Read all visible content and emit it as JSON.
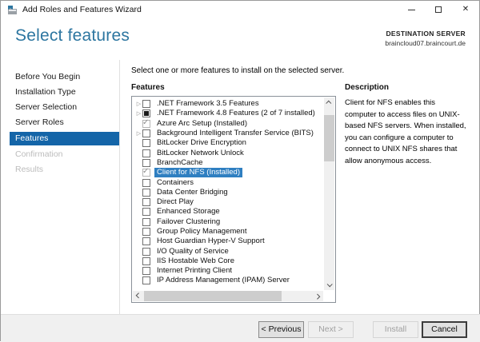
{
  "window": {
    "title": "Add Roles and Features Wizard"
  },
  "icons": {
    "expand": "▷",
    "check": "✓",
    "close": "✕"
  },
  "header": {
    "title": "Select features",
    "destination_label": "DESTINATION SERVER",
    "destination_server": "braincloud07.braincourt.de"
  },
  "sidebar": {
    "items": [
      {
        "label": "Before You Begin",
        "state": "normal"
      },
      {
        "label": "Installation Type",
        "state": "normal"
      },
      {
        "label": "Server Selection",
        "state": "normal"
      },
      {
        "label": "Server Roles",
        "state": "normal"
      },
      {
        "label": "Features",
        "state": "selected"
      },
      {
        "label": "Confirmation",
        "state": "disabled"
      },
      {
        "label": "Results",
        "state": "disabled"
      }
    ]
  },
  "main": {
    "instruction": "Select one or more features to install on the selected server.",
    "features_label": "Features",
    "description_label": "Description",
    "description_text": "Client for NFS enables this computer to access files on UNIX-based NFS servers. When installed, you can configure a computer to connect to UNIX NFS shares that allow anonymous access.",
    "features": [
      {
        "label": ".NET Framework 3.5 Features",
        "checkbox": "unchecked",
        "expandable": true,
        "selected": false
      },
      {
        "label": ".NET Framework 4.8 Features (2 of 7 installed)",
        "checkbox": "partial",
        "expandable": true,
        "selected": false
      },
      {
        "label": "Azure Arc Setup (Installed)",
        "checkbox": "checked",
        "expandable": false,
        "selected": false
      },
      {
        "label": "Background Intelligent Transfer Service (BITS)",
        "checkbox": "unchecked",
        "expandable": true,
        "selected": false
      },
      {
        "label": "BitLocker Drive Encryption",
        "checkbox": "unchecked",
        "expandable": false,
        "selected": false
      },
      {
        "label": "BitLocker Network Unlock",
        "checkbox": "unchecked",
        "expandable": false,
        "selected": false
      },
      {
        "label": "BranchCache",
        "checkbox": "unchecked",
        "expandable": false,
        "selected": false
      },
      {
        "label": "Client for NFS (Installed)",
        "checkbox": "checked",
        "expandable": false,
        "selected": true
      },
      {
        "label": "Containers",
        "checkbox": "unchecked",
        "expandable": false,
        "selected": false
      },
      {
        "label": "Data Center Bridging",
        "checkbox": "unchecked",
        "expandable": false,
        "selected": false
      },
      {
        "label": "Direct Play",
        "checkbox": "unchecked",
        "expandable": false,
        "selected": false
      },
      {
        "label": "Enhanced Storage",
        "checkbox": "unchecked",
        "expandable": false,
        "selected": false
      },
      {
        "label": "Failover Clustering",
        "checkbox": "unchecked",
        "expandable": false,
        "selected": false
      },
      {
        "label": "Group Policy Management",
        "checkbox": "unchecked",
        "expandable": false,
        "selected": false
      },
      {
        "label": "Host Guardian Hyper-V Support",
        "checkbox": "unchecked",
        "expandable": false,
        "selected": false
      },
      {
        "label": "I/O Quality of Service",
        "checkbox": "unchecked",
        "expandable": false,
        "selected": false
      },
      {
        "label": "IIS Hostable Web Core",
        "checkbox": "unchecked",
        "expandable": false,
        "selected": false
      },
      {
        "label": "Internet Printing Client",
        "checkbox": "unchecked",
        "expandable": false,
        "selected": false
      },
      {
        "label": "IP Address Management (IPAM) Server",
        "checkbox": "unchecked",
        "expandable": false,
        "selected": false
      }
    ]
  },
  "footer": {
    "buttons": [
      {
        "label": "< Previous",
        "enabled": true,
        "focused": false,
        "key": "previous"
      },
      {
        "label": "Next >",
        "enabled": false,
        "focused": false,
        "key": "next"
      },
      {
        "label": "Install",
        "enabled": false,
        "focused": false,
        "key": "install"
      },
      {
        "label": "Cancel",
        "enabled": true,
        "focused": true,
        "key": "cancel"
      }
    ]
  },
  "colors": {
    "header_title_blue": "#2d76a0",
    "nav_selected_blue": "#1465a8",
    "row_selected_blue": "#2f7fc1",
    "footer_gray": "#f0f0f0"
  }
}
